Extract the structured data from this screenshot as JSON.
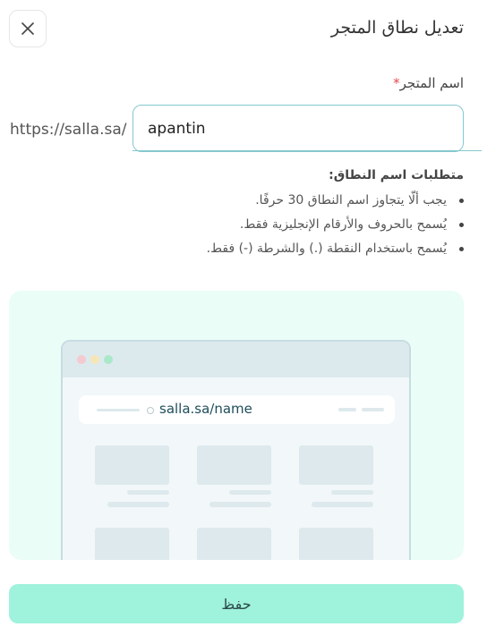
{
  "header": {
    "title": "تعديل نطاق المتجر",
    "close_icon": "close-icon"
  },
  "form": {
    "label": "اسم المتجر",
    "required_mark": "*",
    "prefix": "https://salla.sa/",
    "value": "apantin"
  },
  "requirements": {
    "title": "متطلبات اسم النطاق:",
    "items": [
      "يجب ألّا يتجاوز اسم النطاق 30 حرفًا.",
      "يُسمح بالحروف والأرقام الإنجليزية فقط.",
      "يُسمح باستخدام النقطة (.) والشرطة (-) فقط."
    ]
  },
  "illustration": {
    "url": "salla.sa/name",
    "dot_colors": [
      "#f4c9cf",
      "#f6e6b5",
      "#a9e8c8"
    ]
  },
  "footer": {
    "save_label": "حفظ"
  },
  "colors": {
    "accent": "#9ff2dc",
    "input_border": "#86c8cf",
    "required": "#e5484d"
  }
}
